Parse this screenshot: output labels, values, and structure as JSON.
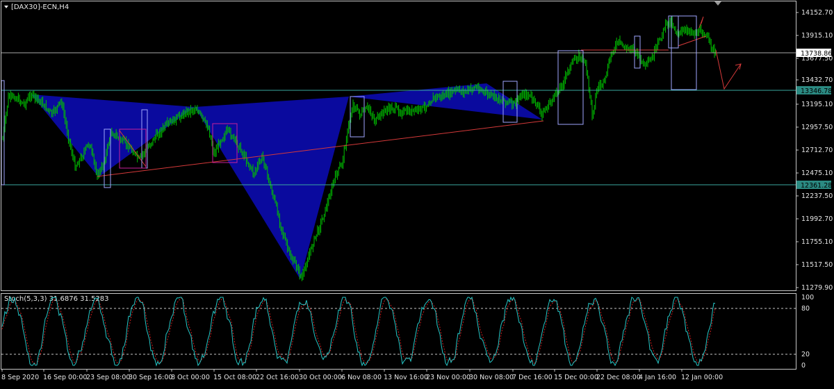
{
  "window": {
    "title": "[DAX30]-ECN,H4"
  },
  "colors": {
    "background": "#000000",
    "frame": "#c8c8c8",
    "candle": "#00c000",
    "pattern_fill": "#0a0a9e",
    "trendline": "#d63a3a",
    "level_line": "#3aa8a0",
    "current_price_line": "#a8a8a8",
    "box_outline": "#a0a6ff",
    "magenta_box": "#c8209a",
    "stoch_main": "#26c6c6",
    "stoch_signal": "#d02020"
  },
  "main_chart": {
    "price_labels": [
      "14152.70",
      "13915.10",
      "13677.50",
      "13432.70",
      "13195.10",
      "12957.50",
      "12712.70",
      "12475.10",
      "12237.50",
      "11992.70",
      "11755.10",
      "11517.50",
      "11279.90"
    ],
    "current_price_tag": "13738.86",
    "level_tag_upper": "13346.78",
    "level_tag_lower": "12361.28"
  },
  "stochastic": {
    "label": "Stoch(5,3,3) 31.6876 31.5283",
    "level_labels": [
      "100",
      "80",
      "20",
      "0"
    ]
  },
  "x_axis": {
    "labels": [
      "8 Sep 2020",
      "16 Sep 00:00",
      "23 Sep 08:00",
      "30 Sep 16:00",
      "8 Oct 00:00",
      "15 Oct 08:00",
      "22 Oct 16:00",
      "30 Oct 00:00",
      "6 Nov 08:00",
      "13 Nov 16:00",
      "23 Nov 00:00",
      "30 Nov 08:00",
      "7 Dec 16:00",
      "15 Dec 00:00",
      "22 Dec 08:00",
      "4 Jan 16:00",
      "12 Jan 00:00"
    ]
  },
  "chart_data": {
    "type": "candlestick",
    "symbol": "[DAX30]-ECN,H4",
    "price_ylim": [
      11279.9,
      14152.7
    ],
    "x": [
      "8 Sep 2020",
      "16 Sep 00:00",
      "23 Sep 08:00",
      "30 Sep 16:00",
      "8 Oct 00:00",
      "15 Oct 08:00",
      "22 Oct 16:00",
      "30 Oct 00:00",
      "6 Nov 08:00",
      "13 Nov 16:00",
      "23 Nov 00:00",
      "30 Nov 08:00",
      "7 Dec 16:00",
      "15 Dec 00:00",
      "22 Dec 08:00",
      "4 Jan 16:00",
      "12 Jan 00:00"
    ],
    "close_approx": [
      13050,
      13250,
      12550,
      12850,
      13150,
      12750,
      12650,
      11400,
      13050,
      13200,
      13250,
      13300,
      13200,
      13700,
      13850,
      14050,
      13750
    ],
    "current_price": 13738.86,
    "levels": [
      13346.78,
      12361.28
    ],
    "stochastic": {
      "params": "5,3,3",
      "main": 31.6876,
      "signal": 31.5283,
      "levels": [
        80,
        20
      ],
      "ylim": [
        0,
        100
      ]
    }
  }
}
